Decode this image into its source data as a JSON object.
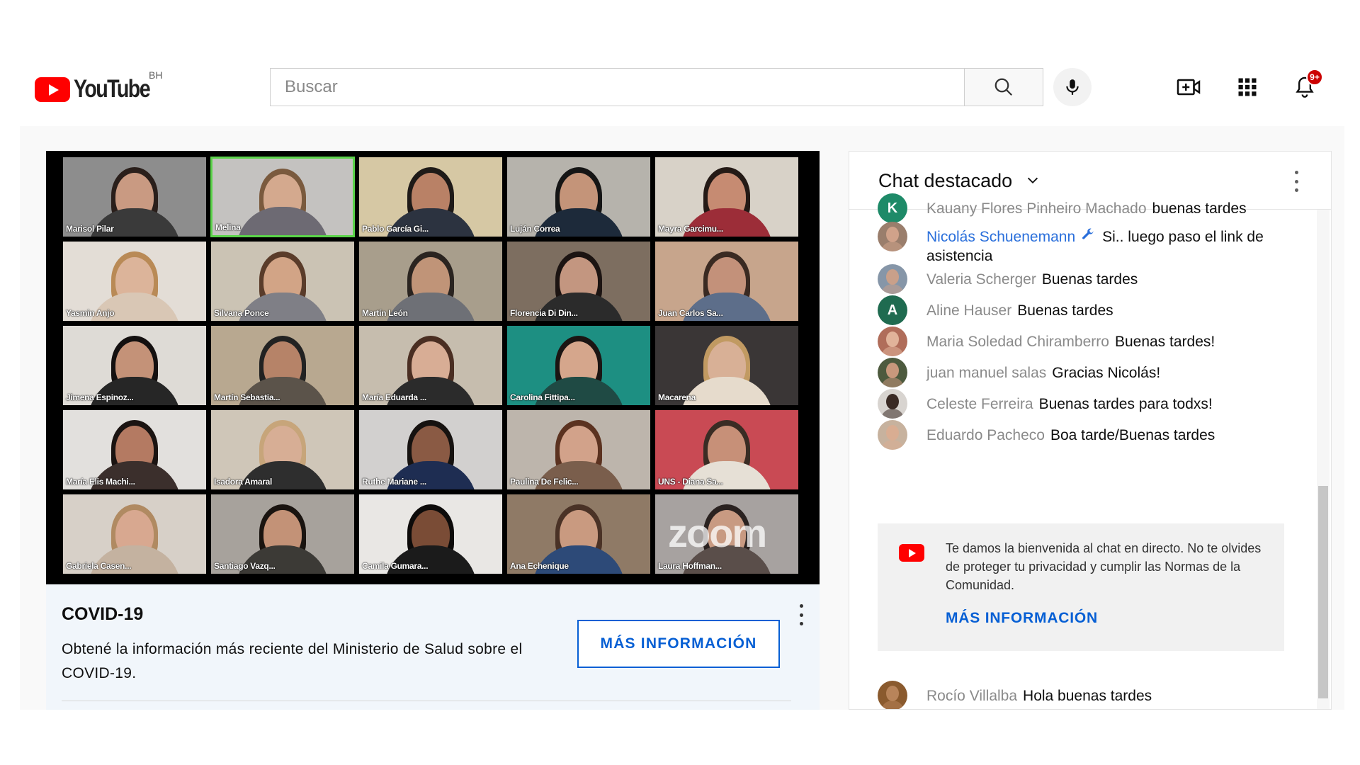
{
  "header": {
    "logo_text": "YouTube",
    "country_code": "BH",
    "search_placeholder": "Buscar",
    "notifications_count": "9+",
    "icons": [
      "youtube-logo-icon",
      "search-icon",
      "microphone-icon",
      "create-video-icon",
      "apps-grid-icon",
      "notifications-bell-icon"
    ]
  },
  "video": {
    "watermark": "zoom",
    "participants": [
      {
        "name": "Marisol Pilar",
        "bg": "#8d8d8d",
        "skin": "#c99a82",
        "hair": "#2a1f1b",
        "shirt": "#3a3a3a"
      },
      {
        "name": "Melina",
        "bg": "#c4c2c0",
        "skin": "#d4a98e",
        "hair": "#7a5a3e",
        "shirt": "#6d6a73",
        "active": true
      },
      {
        "name": "Pablo García Gi...",
        "bg": "#d6c8a4",
        "skin": "#b98166",
        "hair": "#1e1a18",
        "shirt": "#2c3340"
      },
      {
        "name": "Luján Correa",
        "bg": "#b6b3ac",
        "skin": "#c49479",
        "hair": "#151515",
        "shirt": "#1d2a3a"
      },
      {
        "name": "Mayra Garcimu...",
        "bg": "#d8d2c8",
        "skin": "#c68b72",
        "hair": "#241a16",
        "shirt": "#9c2d38"
      },
      {
        "name": "Yasmin Anjo",
        "bg": "#e3ddd6",
        "skin": "#dcb49a",
        "hair": "#b98a56",
        "shirt": "#d9c7b5"
      },
      {
        "name": "Silvana Ponce",
        "bg": "#cbc3b4",
        "skin": "#d2a486",
        "hair": "#5a3c2a",
        "shirt": "#7f7f86"
      },
      {
        "name": "Martín León",
        "bg": "#a89e8c",
        "skin": "#c09478",
        "hair": "#2a2420",
        "shirt": "#6e7076"
      },
      {
        "name": "Florencia Di Din...",
        "bg": "#7d6e60",
        "skin": "#c39680",
        "hair": "#1c1412",
        "shirt": "#2b2b2b"
      },
      {
        "name": "Juan Carlos Sa...",
        "bg": "#c7a58c",
        "skin": "#c3917a",
        "hair": "#3a2a22",
        "shirt": "#5d6e8a"
      },
      {
        "name": "Jimena Espinoz...",
        "bg": "#dedbd6",
        "skin": "#c49278",
        "hair": "#141010",
        "shirt": "#262626"
      },
      {
        "name": "Martín Sebastia...",
        "bg": "#b8a890",
        "skin": "#b68368",
        "hair": "#222",
        "shirt": "#5b534a"
      },
      {
        "name": "María Eduarda ...",
        "bg": "#c6bdae",
        "skin": "#d8ad95",
        "hair": "#4a2e22",
        "shirt": "#2b2b2b"
      },
      {
        "name": "Carolina Fittipa...",
        "bg": "#1d8f82",
        "skin": "#d5a68c",
        "hair": "#1b1513",
        "shirt": "#1f4a44"
      },
      {
        "name": "Macarena",
        "bg": "#3a3636",
        "skin": "#d8b096",
        "hair": "#c19a62",
        "shirt": "#e6dbcc"
      },
      {
        "name": "María Elis Machi...",
        "bg": "#e2e0dd",
        "skin": "#b47a62",
        "hair": "#1b1412",
        "shirt": "#3b2f2c"
      },
      {
        "name": "Isadora Amaral",
        "bg": "#cfc6b8",
        "skin": "#d7ae95",
        "hair": "#c7a57a",
        "shirt": "#2e2e2e"
      },
      {
        "name": "Ruthe Mariane ...",
        "bg": "#d2d0cf",
        "skin": "#8a5a44",
        "hair": "#161210",
        "shirt": "#1e2d52"
      },
      {
        "name": "Paulina De Felic...",
        "bg": "#bdb5ac",
        "skin": "#d2a28a",
        "hair": "#5b3220",
        "shirt": "#7a5e4c"
      },
      {
        "name": "UNS - Diana Sa...",
        "bg": "#c94a54",
        "skin": "#c79078",
        "hair": "#3a2c24",
        "shirt": "#e6e0d6"
      },
      {
        "name": "Gabriela Casen...",
        "bg": "#d7d0c8",
        "skin": "#d8a890",
        "hair": "#b08a62",
        "shirt": "#c4b2a0"
      },
      {
        "name": "Santiago Vazq...",
        "bg": "#a7a29c",
        "skin": "#c39277",
        "hair": "#1a1410",
        "shirt": "#3c3a36"
      },
      {
        "name": "Camila Gumara...",
        "bg": "#e9e7e4",
        "skin": "#7a4c36",
        "hair": "#0d0b0a",
        "shirt": "#1b1b1b"
      },
      {
        "name": "Ana Echenique",
        "bg": "#8f7a66",
        "skin": "#c99a80",
        "hair": "#4a3226",
        "shirt": "#2d4a78"
      },
      {
        "name": "Laura Hoffman...",
        "bg": "#a7a2a0",
        "skin": "#c89a82",
        "hair": "#2a2220",
        "shirt": "#5a4e4a",
        "zoom": true
      }
    ]
  },
  "info_panel": {
    "title": "COVID-19",
    "description": "Obtené la información más reciente del Ministerio de Salud sobre el COVID-19.",
    "button_label": "MÁS INFORMACIÓN"
  },
  "chat": {
    "title": "Chat destacado",
    "messages": [
      {
        "author": "Kauany Flores Pinheiro Machado",
        "text": "buenas tardes",
        "avatar_letter": "K",
        "avatar_color": "#1e8a68"
      },
      {
        "author": "Nicolás Schuenemann",
        "text": "Si.. luego paso el link de asistencia",
        "owner": true,
        "avatar_color": "#9a7e6c",
        "avatar_skin": "#d0a28a"
      },
      {
        "author": "Valeria Scherger",
        "text": "Buenas tardes",
        "avatar_color": "#8696a8",
        "avatar_skin": "#c9a08a"
      },
      {
        "author": "Aline Hauser",
        "text": "Buenas tardes",
        "avatar_letter": "A",
        "avatar_color": "#1f6b50"
      },
      {
        "author": "Maria Soledad Chiramberro",
        "text": "Buenas tardes!",
        "avatar_color": "#b06d5a",
        "avatar_skin": "#e1b39a"
      },
      {
        "author": "juan manuel salas",
        "text": "Gracias Nicolás!",
        "avatar_color": "#4d5a3e",
        "avatar_skin": "#c8987c"
      },
      {
        "author": "Celeste Ferreira",
        "text": "Buenas tardes para todxs!",
        "avatar_color": "#d8d4d0",
        "avatar_skin": "#3a2a24"
      },
      {
        "author": "Eduardo Pacheco",
        "text": "Boa tarde/Buenas tardes",
        "avatar_color": "#c7b29e",
        "avatar_skin": "#d9ad92"
      },
      {
        "author": "Rocío Villalba",
        "text": "Hola buenas tardes",
        "avatar_color": "#8a5a2e",
        "avatar_skin": "#b8845a"
      }
    ],
    "welcome": {
      "text": "Te damos la bienvenida al chat en directo. No te olvides de proteger tu privacidad y cumplir las Normas de la Comunidad.",
      "link_label": "MÁS INFORMACIÓN"
    }
  }
}
